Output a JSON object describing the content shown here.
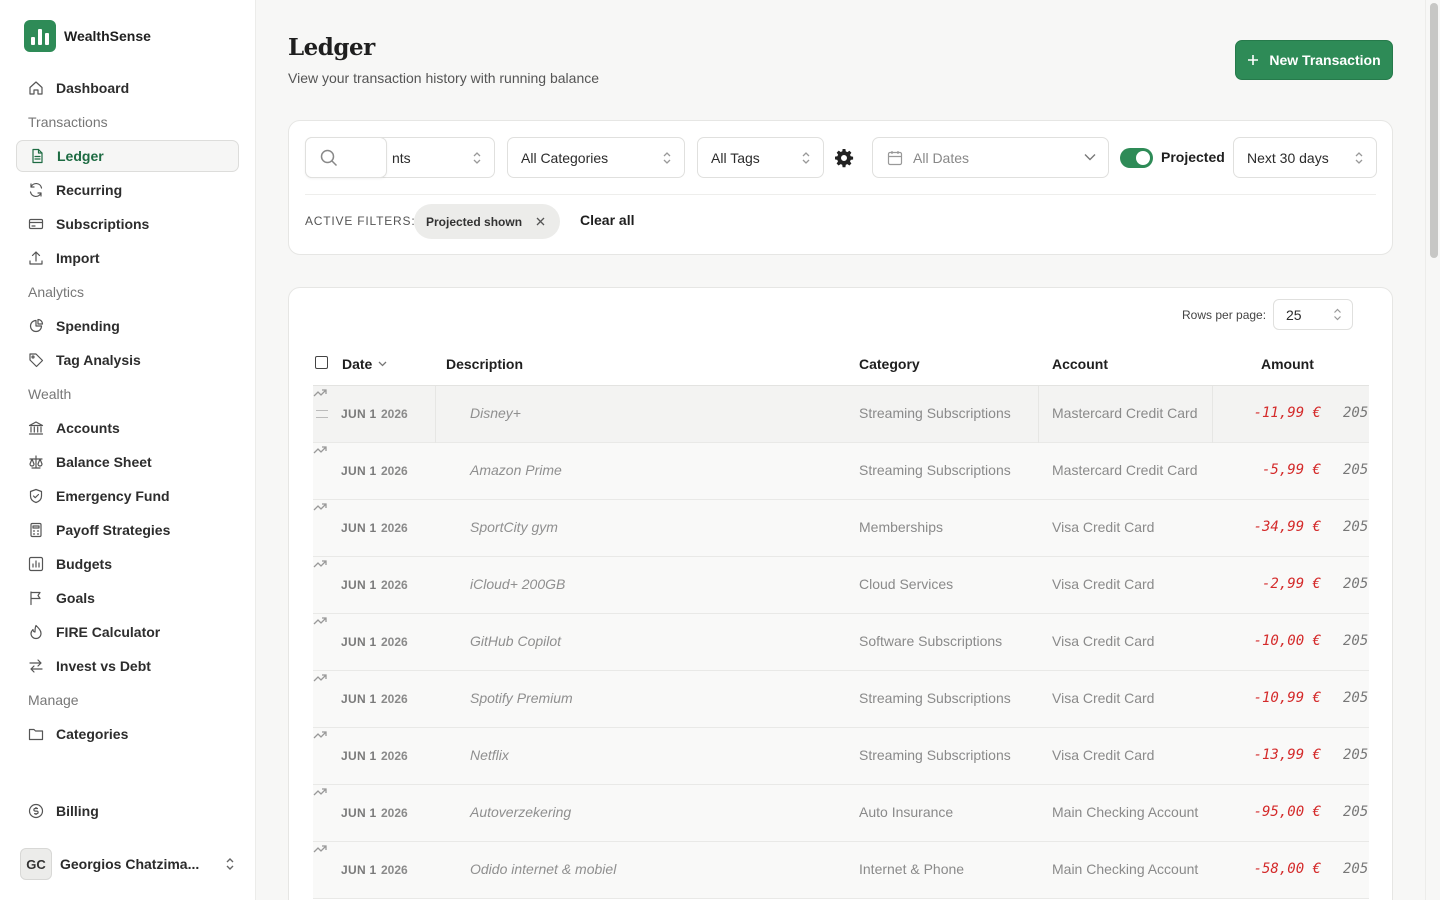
{
  "brand": {
    "name": "WealthSense"
  },
  "sidebar": {
    "items": [
      {
        "type": "item",
        "label": "Dashboard",
        "icon": "home-icon"
      },
      {
        "type": "section",
        "label": "Transactions"
      },
      {
        "type": "item",
        "label": "Ledger",
        "icon": "document-icon",
        "active": true
      },
      {
        "type": "item",
        "label": "Recurring",
        "icon": "refresh-icon"
      },
      {
        "type": "item",
        "label": "Subscriptions",
        "icon": "credit-card-icon"
      },
      {
        "type": "item",
        "label": "Import",
        "icon": "upload-icon"
      },
      {
        "type": "section",
        "label": "Analytics"
      },
      {
        "type": "item",
        "label": "Spending",
        "icon": "pie-chart-icon"
      },
      {
        "type": "item",
        "label": "Tag Analysis",
        "icon": "tag-icon"
      },
      {
        "type": "section",
        "label": "Wealth"
      },
      {
        "type": "item",
        "label": "Accounts",
        "icon": "bank-icon"
      },
      {
        "type": "item",
        "label": "Balance Sheet",
        "icon": "scale-icon"
      },
      {
        "type": "item",
        "label": "Emergency Fund",
        "icon": "shield-icon"
      },
      {
        "type": "item",
        "label": "Payoff Strategies",
        "icon": "calculator-icon"
      },
      {
        "type": "item",
        "label": "Budgets",
        "icon": "bar-chart-icon"
      },
      {
        "type": "item",
        "label": "Goals",
        "icon": "flag-icon"
      },
      {
        "type": "item",
        "label": "FIRE Calculator",
        "icon": "flame-icon"
      },
      {
        "type": "item",
        "label": "Invest vs Debt",
        "icon": "swap-icon"
      },
      {
        "type": "section",
        "label": "Manage"
      },
      {
        "type": "item",
        "label": "Categories",
        "icon": "folder-icon"
      }
    ],
    "billing": {
      "label": "Billing",
      "icon": "dollar-circle-icon"
    },
    "user": {
      "initials": "GC",
      "name": "Georgios Chatzima..."
    }
  },
  "header": {
    "title": "Ledger",
    "subtitle": "View your transaction history with running balance",
    "new_button": "New Transaction"
  },
  "filters": {
    "accounts": "nts",
    "categories": "All Categories",
    "tags": "All Tags",
    "dates_placeholder": "All Dates",
    "projected_label": "Projected",
    "projected_on": true,
    "range": "Next 30 days",
    "active_label": "ACTIVE FILTERS:",
    "chip": "Projected shown",
    "clear": "Clear all"
  },
  "table": {
    "rows_per_page_label": "Rows per page:",
    "rows_per_page": "25",
    "columns": {
      "date": "Date",
      "description": "Description",
      "category": "Category",
      "account": "Account",
      "amount": "Amount"
    },
    "rows": [
      {
        "date": "JUN 1",
        "year": "2026",
        "description": "Disney+",
        "category": "Streaming Subscriptions",
        "account": "Mastercard Credit Card",
        "amount": "-11,99 €",
        "balance": "205"
      },
      {
        "date": "JUN 1",
        "year": "2026",
        "description": "Amazon Prime",
        "category": "Streaming Subscriptions",
        "account": "Mastercard Credit Card",
        "amount": "-5,99 €",
        "balance": "205"
      },
      {
        "date": "JUN 1",
        "year": "2026",
        "description": "SportCity gym",
        "category": "Memberships",
        "account": "Visa Credit Card",
        "amount": "-34,99 €",
        "balance": "205"
      },
      {
        "date": "JUN 1",
        "year": "2026",
        "description": "iCloud+ 200GB",
        "category": "Cloud Services",
        "account": "Visa Credit Card",
        "amount": "-2,99 €",
        "balance": "205"
      },
      {
        "date": "JUN 1",
        "year": "2026",
        "description": "GitHub Copilot",
        "category": "Software Subscriptions",
        "account": "Visa Credit Card",
        "amount": "-10,00 €",
        "balance": "205"
      },
      {
        "date": "JUN 1",
        "year": "2026",
        "description": "Spotify Premium",
        "category": "Streaming Subscriptions",
        "account": "Visa Credit Card",
        "amount": "-10,99 €",
        "balance": "205"
      },
      {
        "date": "JUN 1",
        "year": "2026",
        "description": "Netflix",
        "category": "Streaming Subscriptions",
        "account": "Visa Credit Card",
        "amount": "-13,99 €",
        "balance": "205"
      },
      {
        "date": "JUN 1",
        "year": "2026",
        "description": "Autoverzekering",
        "category": "Auto Insurance",
        "account": "Main Checking Account",
        "amount": "-95,00 €",
        "balance": "205"
      },
      {
        "date": "JUN 1",
        "year": "2026",
        "description": "Odido internet & mobiel",
        "category": "Internet & Phone",
        "account": "Main Checking Account",
        "amount": "-58,00 €",
        "balance": "205"
      }
    ]
  },
  "colors": {
    "accent": "#2e8b57",
    "negative": "#d42b2b"
  }
}
